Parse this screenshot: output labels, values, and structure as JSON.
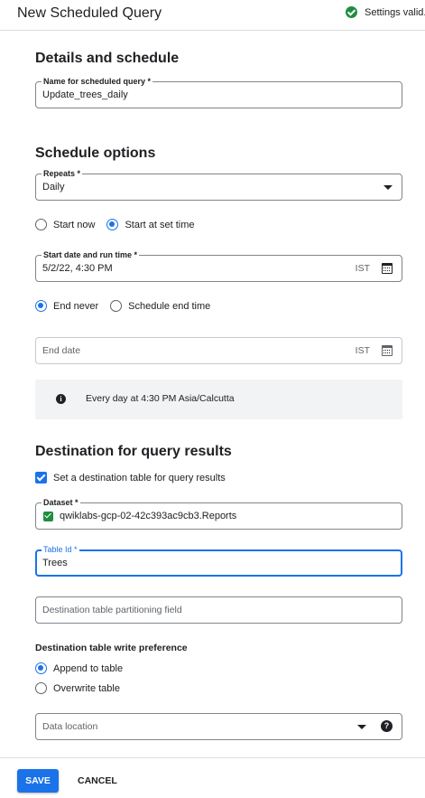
{
  "header": {
    "title": "New Scheduled Query",
    "status": "Settings valid."
  },
  "details": {
    "heading": "Details and schedule",
    "name_label": "Name for scheduled query *",
    "name_value": "Update_trees_daily"
  },
  "schedule": {
    "heading": "Schedule options",
    "repeats_label": "Repeats *",
    "repeats_value": "Daily",
    "start_options": [
      {
        "label": "Start now",
        "selected": false
      },
      {
        "label": "Start at set time",
        "selected": true
      }
    ],
    "start_label": "Start date and run time *",
    "start_value": "5/2/22, 4:30 PM",
    "timezone": "IST",
    "end_options": [
      {
        "label": "End never",
        "selected": true
      },
      {
        "label": "Schedule end time",
        "selected": false
      }
    ],
    "end_date_placeholder": "End date",
    "end_timezone": "IST",
    "summary": "Every day at 4:30 PM Asia/Calcutta"
  },
  "destination": {
    "heading": "Destination for query results",
    "set_table_label": "Set a destination table for query results",
    "set_table_checked": true,
    "dataset_label": "Dataset *",
    "dataset_value": "qwiklabs-gcp-02-42c393ac9cb3.Reports",
    "table_label": "Table Id *",
    "table_value": "Trees",
    "partition_placeholder": "Destination table partitioning field",
    "write_pref_heading": "Destination table write preference",
    "write_options": [
      {
        "label": "Append to table",
        "selected": true
      },
      {
        "label": "Overwrite table",
        "selected": false
      }
    ],
    "data_location_placeholder": "Data location"
  },
  "footer": {
    "save_label": "SAVE",
    "cancel_label": "CANCEL"
  },
  "colors": {
    "accent": "#1a73e8",
    "success": "#1e8e3e",
    "border": "#80868b",
    "info_bg": "#f1f3f4"
  }
}
